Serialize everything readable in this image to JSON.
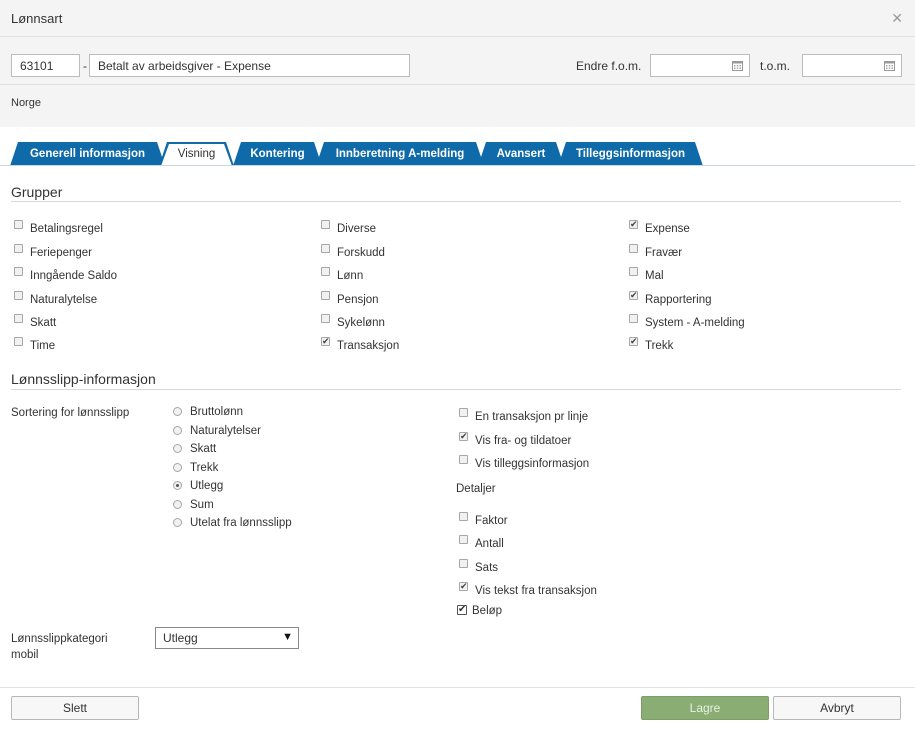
{
  "dialog": {
    "title": "Lønnsart"
  },
  "header": {
    "code": "63101",
    "name": "Betalt av arbeidsgiver - Expense",
    "endre_label": "Endre f.o.m.",
    "endre_value": "",
    "tom_label": "t.o.m.",
    "tom_value": "",
    "country": "Norge"
  },
  "tabs": [
    "Generell informasjon",
    "Visning",
    "Kontering",
    "Innberetning A-melding",
    "Avansert",
    "Tilleggsinformasjon"
  ],
  "active_tab": "Visning",
  "grupper": {
    "heading": "Grupper",
    "items": [
      {
        "label": "Betalingsregel",
        "checked": false
      },
      {
        "label": "Feriepenger",
        "checked": false
      },
      {
        "label": "Inngående Saldo",
        "checked": false
      },
      {
        "label": "Naturalytelse",
        "checked": false
      },
      {
        "label": "Skatt",
        "checked": false
      },
      {
        "label": "Time",
        "checked": false
      },
      {
        "label": "Diverse",
        "checked": false
      },
      {
        "label": "Forskudd",
        "checked": false
      },
      {
        "label": "Lønn",
        "checked": false
      },
      {
        "label": "Pensjon",
        "checked": false
      },
      {
        "label": "Sykelønn",
        "checked": false
      },
      {
        "label": "Transaksjon",
        "checked": true
      },
      {
        "label": "Expense",
        "checked": true
      },
      {
        "label": "Fravær",
        "checked": false
      },
      {
        "label": "Mal",
        "checked": false
      },
      {
        "label": "Rapportering",
        "checked": true
      },
      {
        "label": "System - A-melding",
        "checked": false
      },
      {
        "label": "Trekk",
        "checked": true
      }
    ]
  },
  "lonnsslipp": {
    "heading": "Lønnsslipp-informasjon",
    "sort_label": "Sortering for lønnsslipp",
    "sort_options": [
      {
        "label": "Bruttolønn",
        "selected": false
      },
      {
        "label": "Naturalytelser",
        "selected": false
      },
      {
        "label": "Skatt",
        "selected": false
      },
      {
        "label": "Trekk",
        "selected": false
      },
      {
        "label": "Utlegg",
        "selected": true
      },
      {
        "label": "Sum",
        "selected": false
      },
      {
        "label": "Utelat fra lønnsslipp",
        "selected": false
      }
    ],
    "options": [
      {
        "label": "En transaksjon pr linje",
        "checked": false
      },
      {
        "label": "Vis fra- og tildatoer",
        "checked": true
      },
      {
        "label": "Vis tilleggsinformasjon",
        "checked": false
      }
    ],
    "detaljer_label": "Detaljer",
    "detaljer": [
      {
        "label": "Faktor",
        "checked": false
      },
      {
        "label": "Antall",
        "checked": false
      },
      {
        "label": "Sats",
        "checked": false
      },
      {
        "label": "Vis tekst fra transaksjon",
        "checked": true
      },
      {
        "label": "Beløp",
        "checked": true
      }
    ],
    "kategori_label_1": "Lønnsslippkategori",
    "kategori_label_2": "mobil",
    "kategori_value": "Utlegg"
  },
  "footer": {
    "delete": "Slett",
    "save": "Lagre",
    "cancel": "Avbryt"
  }
}
